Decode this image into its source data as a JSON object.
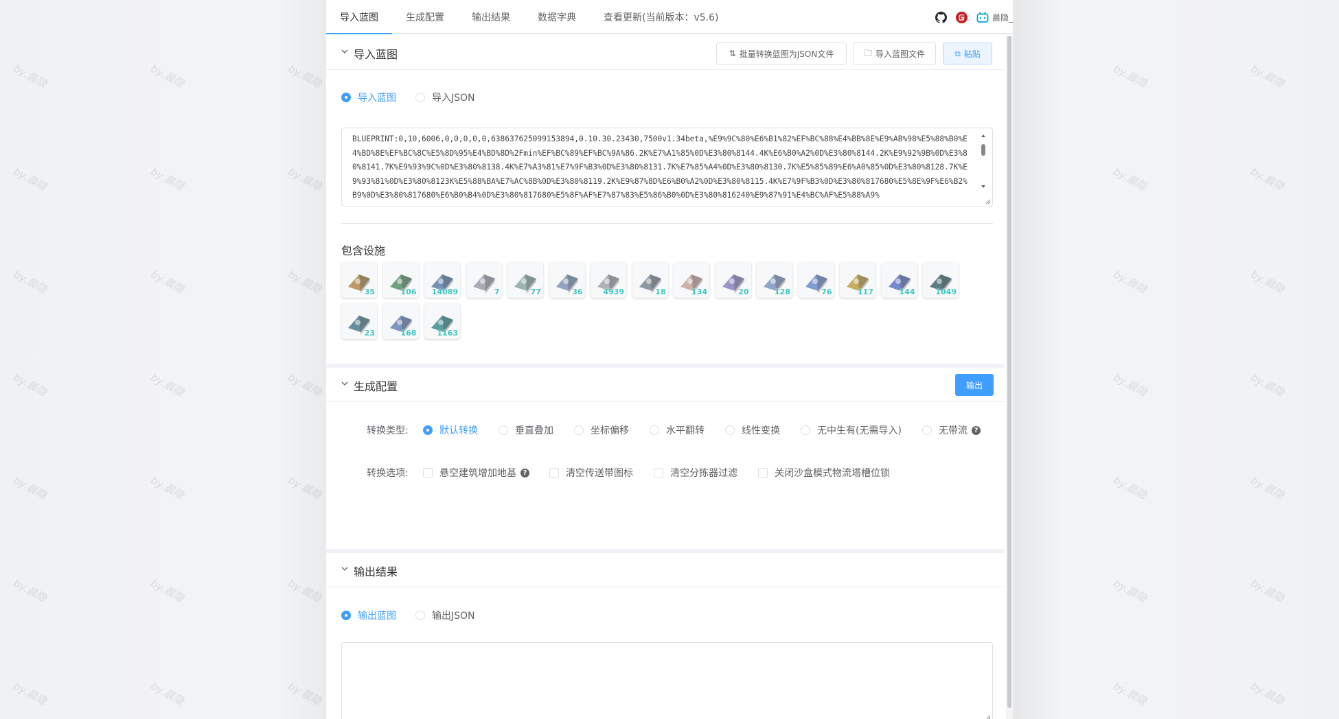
{
  "tabs": [
    {
      "label": "导入蓝图"
    },
    {
      "label": "生成配置"
    },
    {
      "label": "输出结果"
    },
    {
      "label": "数据字典"
    },
    {
      "label": "查看更新(当前版本：v5.6)"
    }
  ],
  "user": {
    "name": "晨隐_"
  },
  "watermark": "by.晨隐",
  "import_section": {
    "title": "导入蓝图",
    "buttons": {
      "batch": "批量转换蓝图为JSON文件",
      "import_file": "导入蓝图文件",
      "paste": "粘贴"
    },
    "radios": [
      {
        "label": "导入蓝图",
        "selected": true
      },
      {
        "label": "导入JSON",
        "selected": false
      }
    ],
    "blueprint_text": "BLUEPRINT:0,10,6006,0,0,0,0,0,638637625099153894,0.10.30.23430,7500v1.34beta,%E9%9C%80%E6%B1%82%EF%BC%88%E4%BB%8E%E9%AB%98%E5%88%B0%E4%BD%8E%EF%BC%8C%E5%8D%95%E4%BD%8D%2Fmin%EF%BC%89%EF%BC%9A%86.2K%E7%A1%85%0D%E3%80%8144.4K%E6%B0%A2%0D%E3%80%8144.2K%E9%92%9B%0D%E3%80%8141.7K%E9%93%9C%0D%E3%80%8138.4K%E7%A3%81%E7%9F%B3%0D%E3%80%8131.7K%E7%85%A4%0D%E3%80%8130.7K%E5%85%89%E6%A0%85%0D%E3%80%8128.7K%E9%93%81%0D%E3%80%8123K%E5%88%BA%E7%AC%8B%0D%E3%80%8119.2K%E9%87%8D%E6%B0%A2%0D%E3%80%8115.4K%E7%9F%B3%0D%E3%80%817680%E5%8E%9F%E6%B2%B9%0D%E3%80%817680%E6%B0%B4%0D%E3%80%817680%E5%8F%AF%E7%87%83%E5%86%B0%0D%E3%80%816240%E9%87%91%E4%BC%AF%E5%88%A9%",
    "facilities_label": "包含设施",
    "facilities": [
      {
        "icon": "conveyor-belt-mk1-icon",
        "count": "35"
      },
      {
        "icon": "conveyor-belt-mk2-icon",
        "count": "106"
      },
      {
        "icon": "conveyor-belt-mk3-icon",
        "count": "14089"
      },
      {
        "icon": "sorter-mk1-icon",
        "count": "7"
      },
      {
        "icon": "sorter-mk2-icon",
        "count": "77"
      },
      {
        "icon": "sorter-mk3-icon",
        "count": "36"
      },
      {
        "icon": "pile-sorter-icon",
        "count": "4939"
      },
      {
        "icon": "tesla-tower-icon",
        "count": "18"
      },
      {
        "icon": "wireless-power-tower-icon",
        "count": "134"
      },
      {
        "icon": "satellite-substation-icon",
        "count": "20"
      },
      {
        "icon": "planetary-logistics-station-icon",
        "count": "128"
      },
      {
        "icon": "interstellar-logistics-station-icon",
        "count": "76"
      },
      {
        "icon": "smelter-icon",
        "count": "117"
      },
      {
        "icon": "assembler-icon",
        "count": "144"
      },
      {
        "icon": "chemical-plant-icon",
        "count": "1049"
      },
      {
        "icon": "storage-tank-icon",
        "count": "23"
      },
      {
        "icon": "particle-collider-icon",
        "count": "168"
      },
      {
        "icon": "matrix-lab-icon",
        "count": "1163"
      }
    ]
  },
  "config_section": {
    "title": "生成配置",
    "output_button": "输出",
    "type_label": "转换类型:",
    "types": [
      {
        "label": "默认转换",
        "selected": true
      },
      {
        "label": "垂直叠加",
        "selected": false
      },
      {
        "label": "坐标偏移",
        "selected": false
      },
      {
        "label": "水平翻转",
        "selected": false
      },
      {
        "label": "线性变换",
        "selected": false
      },
      {
        "label": "无中生有(无需导入)",
        "selected": false
      },
      {
        "label": "无带流",
        "selected": false
      }
    ],
    "options_label": "转换选项:",
    "options": [
      {
        "label": "悬空建筑增加地基",
        "checked": false
      },
      {
        "label": "清空传送带图标",
        "checked": false
      },
      {
        "label": "清空分拣器过滤",
        "checked": false
      },
      {
        "label": "关闭沙盒模式物流塔槽位锁",
        "checked": false
      }
    ]
  },
  "output_section": {
    "title": "输出结果",
    "radios": [
      {
        "label": "输出蓝图",
        "selected": true
      },
      {
        "label": "输出JSON",
        "selected": false
      }
    ],
    "output_text": ""
  },
  "colors": {
    "accent": "#409eff",
    "count": "#3fc7c0"
  }
}
